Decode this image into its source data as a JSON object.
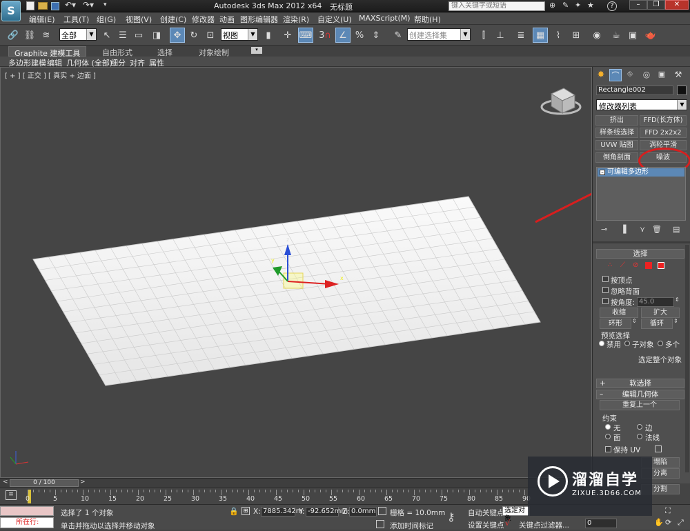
{
  "titlebar": {
    "app_title": "Autodesk 3ds Max  2012 x64",
    "doc_title": "无标题",
    "search_placeholder": "键入关键字或短语"
  },
  "menu": [
    "编辑(E)",
    "工具(T)",
    "组(G)",
    "视图(V)",
    "创建(C)",
    "修改器",
    "动画",
    "图形编辑器",
    "渲染(R)",
    "自定义(U)",
    "MAXScript(M)",
    "帮助(H)"
  ],
  "toolbar": {
    "filter_value": "全部",
    "refcoord_value": "视图",
    "snap_label": "3",
    "selset_value": "创建选择集"
  },
  "ribbon": {
    "tabs": [
      "Graphite 建模工具",
      "自由形式",
      "选择",
      "对象绘制"
    ],
    "subtabs": [
      "多边形建模",
      "编辑",
      "几何体 (全部)",
      "细分",
      "对齐",
      "属性"
    ]
  },
  "viewport": {
    "label": "[ + ] [ 正交 ] [ 真实 + 边面 ]",
    "gizmo_z": "z",
    "gizmo_x": "x",
    "gizmo_y": "y"
  },
  "panel": {
    "object_name": "Rectangle002",
    "modifier_list": "修改器列表",
    "mod_buttons": [
      "挤出",
      "FFD(长方体)",
      "样条线选择",
      "FFD 2x2x2",
      "UVW 贴图",
      "涡轮平滑",
      "倒角剖面",
      "噪波"
    ],
    "stack_item": "可编辑多边形",
    "selection_title": "选择",
    "by_vertex": "按顶点",
    "ignore_backface": "忽略背面",
    "by_angle": "按角度:",
    "angle_value": "45.0",
    "shrink": "收缩",
    "grow": "扩大",
    "ring": "环形",
    "loop": "循环",
    "preview_title": "预览选择",
    "preview_disabled": "禁用",
    "preview_subobj": "子对象",
    "preview_multi": "多个",
    "select_whole": "选定整个对象",
    "soft_sel": "软选择",
    "edit_geom": "编辑几何体",
    "repeat_last": "重复上一个",
    "constraints": "约束",
    "c_none": "无",
    "c_edge": "边",
    "c_face": "面",
    "c_normal": "法线",
    "keep_uv": "保持 UV",
    "collapse": "塌陷",
    "detach": "分离",
    "slice": "分割"
  },
  "timeline": {
    "frame_counter": "0 / 100",
    "ticks": [
      "0",
      "5",
      "10",
      "15",
      "20",
      "25",
      "30",
      "35",
      "40",
      "45",
      "50",
      "55",
      "60",
      "65",
      "70",
      "75",
      "80",
      "85",
      "90"
    ]
  },
  "status": {
    "running": "所在行:",
    "selected": "选择了 1 个对象",
    "hint": "单击并拖动以选择并移动对象",
    "x_label": "X:",
    "x_value": "7885.342m",
    "y_label": "Y:",
    "y_value": "-92.652mm",
    "z_label": "Z:",
    "z_value": "0.0mm",
    "grid": "栅格 = 10.0mm",
    "add_time_tag": "添加时间标记",
    "auto_key": "自动关键点",
    "set_key": "设置关键点",
    "selected_obj": "选定对象",
    "key_filters": "关键点过滤器...",
    "frame_value": "0"
  },
  "watermark": {
    "brand": "溜溜自学",
    "url": "ZIXUE.3D66.COM"
  },
  "colors": {
    "annotation": "#d81e1e",
    "accent": "#5c88b6",
    "grid_plane": "#f2f2f2"
  }
}
